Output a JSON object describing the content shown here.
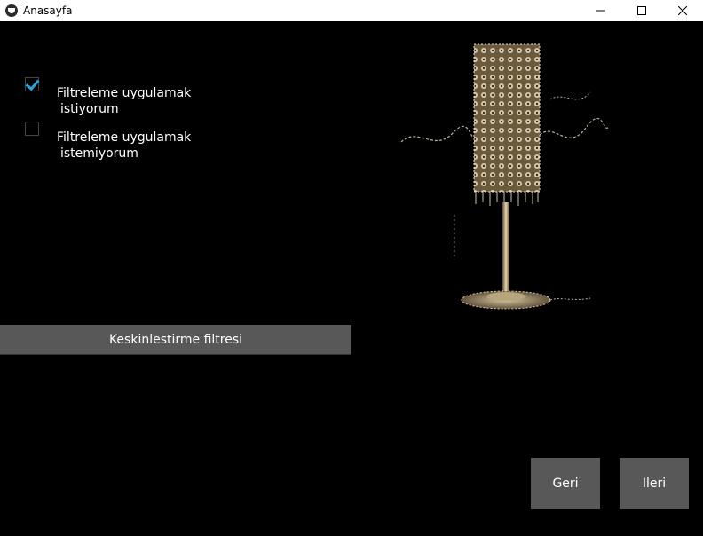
{
  "window": {
    "title": "Anasayfa",
    "icon": "kivy-app-icon"
  },
  "options": [
    {
      "line1": "Filtreleme uygulamak",
      "line2": "istiyorum",
      "checked": true
    },
    {
      "line1": "Filtreleme uygulamak",
      "line2": "istemiyorum",
      "checked": false
    }
  ],
  "filter_button": "Keskinlestirme filtresi",
  "nav": {
    "back": "Geri",
    "next": "Ileri"
  },
  "colors": {
    "checkmark": "#2aa7e0",
    "button_bg": "#585858",
    "background": "#000000"
  }
}
